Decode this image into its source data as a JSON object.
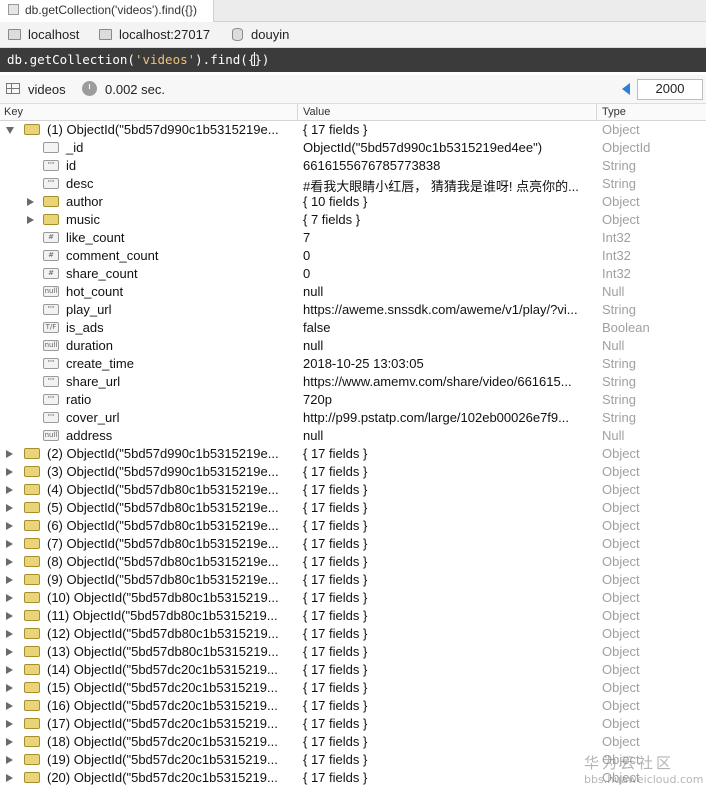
{
  "tab": {
    "title": "db.getCollection('videos').find({})"
  },
  "connection": {
    "host": "localhost",
    "server": "localhost:27017",
    "database": "douyin"
  },
  "query": {
    "prefix": "db.getCollection(",
    "collection": "'videos'",
    "method": ").find(",
    "cursor_left": "{",
    "cursor_right": "})"
  },
  "result": {
    "collection": "videos",
    "time": "0.002 sec.",
    "limit": "2000"
  },
  "columns": {
    "key": "Key",
    "value": "Value",
    "type": "Type"
  },
  "expanded_document": {
    "key": "(1) ObjectId(\"5bd57d990c1b5315219e...",
    "value": "{ 17 fields }",
    "type": "Object",
    "fields": [
      {
        "icon": "",
        "key": "_id",
        "value": "ObjectId(\"5bd57d990c1b5315219ed4ee\")",
        "type": "ObjectId",
        "expandable": false
      },
      {
        "icon": "\"\"",
        "key": "id",
        "value": "6616155676785773838",
        "type": "String",
        "expandable": false
      },
      {
        "icon": "\"\"",
        "key": "desc",
        "value": "#看我大眼睛小红唇， 猜猜我是谁呀! 点亮你的...",
        "type": "String",
        "expandable": false
      },
      {
        "icon": "{}",
        "key": "author",
        "value": "{ 10 fields }",
        "type": "Object",
        "expandable": true
      },
      {
        "icon": "{}",
        "key": "music",
        "value": "{ 7 fields }",
        "type": "Object",
        "expandable": true
      },
      {
        "icon": "#",
        "key": "like_count",
        "value": "7",
        "type": "Int32",
        "expandable": false
      },
      {
        "icon": "#",
        "key": "comment_count",
        "value": "0",
        "type": "Int32",
        "expandable": false
      },
      {
        "icon": "#",
        "key": "share_count",
        "value": "0",
        "type": "Int32",
        "expandable": false
      },
      {
        "icon": "null",
        "key": "hot_count",
        "value": "null",
        "type": "Null",
        "expandable": false
      },
      {
        "icon": "\"\"",
        "key": "play_url",
        "value": "https://aweme.snssdk.com/aweme/v1/play/?vi...",
        "type": "String",
        "expandable": false
      },
      {
        "icon": "T/F",
        "key": "is_ads",
        "value": "false",
        "type": "Boolean",
        "expandable": false
      },
      {
        "icon": "null",
        "key": "duration",
        "value": "null",
        "type": "Null",
        "expandable": false
      },
      {
        "icon": "\"\"",
        "key": "create_time",
        "value": "2018-10-25 13:03:05",
        "type": "String",
        "expandable": false
      },
      {
        "icon": "\"\"",
        "key": "share_url",
        "value": "https://www.amemv.com/share/video/661615...",
        "type": "String",
        "expandable": false
      },
      {
        "icon": "\"\"",
        "key": "ratio",
        "value": "720p",
        "type": "String",
        "expandable": false
      },
      {
        "icon": "\"\"",
        "key": "cover_url",
        "value": "http://p99.pstatp.com/large/102eb00026e7f9...",
        "type": "String",
        "expandable": false
      },
      {
        "icon": "null",
        "key": "address",
        "value": "null",
        "type": "Null",
        "expandable": false
      }
    ]
  },
  "documents": [
    {
      "key": "(2) ObjectId(\"5bd57d990c1b5315219e...",
      "value": "{ 17 fields }",
      "type": "Object"
    },
    {
      "key": "(3) ObjectId(\"5bd57d990c1b5315219e...",
      "value": "{ 17 fields }",
      "type": "Object"
    },
    {
      "key": "(4) ObjectId(\"5bd57db80c1b5315219e...",
      "value": "{ 17 fields }",
      "type": "Object"
    },
    {
      "key": "(5) ObjectId(\"5bd57db80c1b5315219e...",
      "value": "{ 17 fields }",
      "type": "Object"
    },
    {
      "key": "(6) ObjectId(\"5bd57db80c1b5315219e...",
      "value": "{ 17 fields }",
      "type": "Object"
    },
    {
      "key": "(7) ObjectId(\"5bd57db80c1b5315219e...",
      "value": "{ 17 fields }",
      "type": "Object"
    },
    {
      "key": "(8) ObjectId(\"5bd57db80c1b5315219e...",
      "value": "{ 17 fields }",
      "type": "Object"
    },
    {
      "key": "(9) ObjectId(\"5bd57db80c1b5315219e...",
      "value": "{ 17 fields }",
      "type": "Object"
    },
    {
      "key": "(10) ObjectId(\"5bd57db80c1b5315219...",
      "value": "{ 17 fields }",
      "type": "Object"
    },
    {
      "key": "(11) ObjectId(\"5bd57db80c1b5315219...",
      "value": "{ 17 fields }",
      "type": "Object"
    },
    {
      "key": "(12) ObjectId(\"5bd57db80c1b5315219...",
      "value": "{ 17 fields }",
      "type": "Object"
    },
    {
      "key": "(13) ObjectId(\"5bd57db80c1b5315219...",
      "value": "{ 17 fields }",
      "type": "Object"
    },
    {
      "key": "(14) ObjectId(\"5bd57dc20c1b5315219...",
      "value": "{ 17 fields }",
      "type": "Object"
    },
    {
      "key": "(15) ObjectId(\"5bd57dc20c1b5315219...",
      "value": "{ 17 fields }",
      "type": "Object"
    },
    {
      "key": "(16) ObjectId(\"5bd57dc20c1b5315219...",
      "value": "{ 17 fields }",
      "type": "Object"
    },
    {
      "key": "(17) ObjectId(\"5bd57dc20c1b5315219...",
      "value": "{ 17 fields }",
      "type": "Object"
    },
    {
      "key": "(18) ObjectId(\"5bd57dc20c1b5315219...",
      "value": "{ 17 fields }",
      "type": "Object"
    },
    {
      "key": "(19) ObjectId(\"5bd57dc20c1b5315219...",
      "value": "{ 17 fields }",
      "type": "Object"
    },
    {
      "key": "(20) ObjectId(\"5bd57dc20c1b5315219...",
      "value": "{ 17 fields }",
      "type": "Object"
    }
  ],
  "watermark": {
    "brand": "华为云社区",
    "url": "bbs.huaweicloud.com"
  }
}
